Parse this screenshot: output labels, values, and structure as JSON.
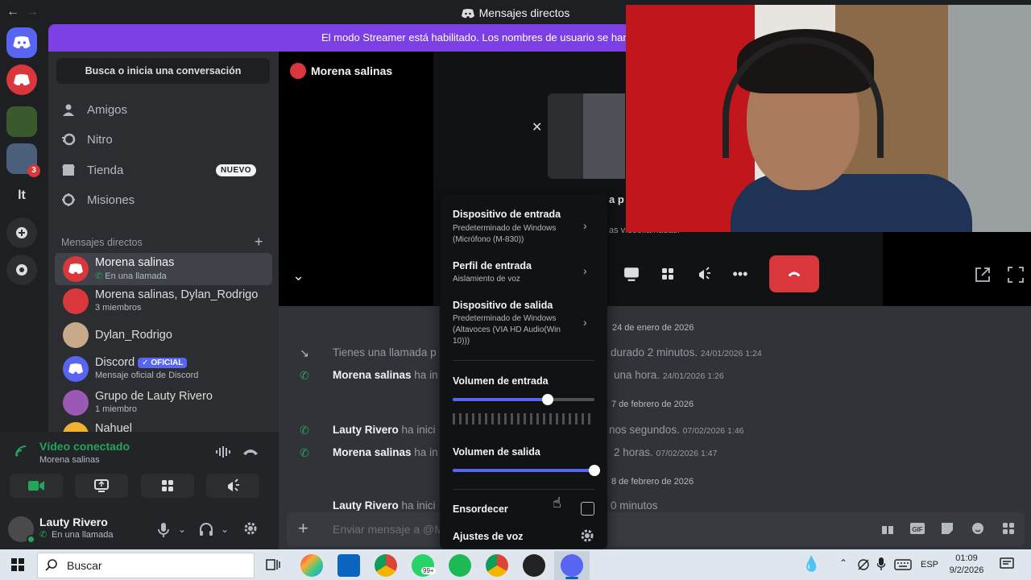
{
  "window": {
    "title": "Mensajes directos",
    "back": "←",
    "forward": "→"
  },
  "banner": {
    "text": "El modo Streamer está habilitado. Los nombres de usuario se han t"
  },
  "sidebar": {
    "search_label": "Busca o inicia una conversación",
    "nav": [
      {
        "label": "Amigos",
        "icon": "friends-icon"
      },
      {
        "label": "Nitro",
        "icon": "nitro-icon"
      },
      {
        "label": "Tienda",
        "icon": "shop-icon",
        "badge": "NUEVO"
      },
      {
        "label": "Misiones",
        "icon": "quests-icon"
      }
    ],
    "dm_header": "Mensajes directos",
    "dm_add": "+",
    "dms": [
      {
        "name": "Morena salinas",
        "sub": "En una llamada",
        "color": "#da373c"
      },
      {
        "name": "Morena salinas, Dylan_Rodrigo",
        "sub": "3 miembros",
        "color": "#da373c"
      },
      {
        "name": "Dylan_Rodrigo",
        "sub": "",
        "color": "#c8a98a"
      },
      {
        "name": "Discord",
        "badge": "OFICIAL",
        "sub": "Mensaje oficial de Discord",
        "color": "#5865f2"
      },
      {
        "name": "Grupo de Lauty Rivero",
        "sub": "1 miembro",
        "color": "#9b59b6"
      },
      {
        "name": "Nahuel",
        "sub": "",
        "color": "#f0b232"
      }
    ]
  },
  "server_rail": {
    "server_label": "lt",
    "badge_count": "3"
  },
  "voice": {
    "title": "Vídeo conectado",
    "subtitle": "Morena salinas"
  },
  "user": {
    "name": "Lauty Rivero",
    "status": "En una llamada"
  },
  "call": {
    "name": "Morena salinas",
    "partial_text": "a p",
    "partial_link": "as videollamadas."
  },
  "chat": {
    "dates": [
      "24 de enero de 2026",
      "7 de febrero de 2026",
      "8 de febrero de 2026"
    ],
    "messages": [
      {
        "left": "Tienes una llamada p",
        "right": "durado 2 minutos.",
        "ts": "24/01/2026 1:24"
      },
      {
        "name": "Morena salinas",
        "left": " ha in",
        "right": "una hora.",
        "ts": "24/01/2026 1:26"
      },
      {
        "name": "Lauty Rivero",
        "left": " ha inici",
        "right": "nos segundos.",
        "ts": "07/02/2026 1:46"
      },
      {
        "name": "Morena salinas",
        "left": " ha in",
        "right": "2 horas.",
        "ts": "07/02/2026 1:47"
      },
      {
        "name": "Lauty Rivero",
        "left": " ha inici",
        "right": "0 minutos",
        "ts": ""
      }
    ],
    "composer_placeholder": "Enviar mensaje a @M"
  },
  "menu": {
    "input_device_title": "Dispositivo de entrada",
    "input_device_sub": "Predeterminado de Windows (Micrófono (M-830))",
    "input_profile_title": "Perfil de entrada",
    "input_profile_sub": "Aislamiento de voz",
    "output_device_title": "Dispositivo de salida",
    "output_device_sub": "Predeterminado de Windows (Altavoces (VIA HD Audio(Win 10)))",
    "input_volume_label": "Volumen de entrada",
    "input_volume": 0.67,
    "output_volume_label": "Volumen de salida",
    "output_volume": 1.0,
    "deafen_label": "Ensordecer",
    "voice_settings_label": "Ajustes de voz"
  },
  "taskbar": {
    "search_label": "Buscar",
    "whatsapp_badge": "99+",
    "language": "ESP",
    "time": "01:09",
    "date": "9/2/2026"
  },
  "colors": {
    "accent": "#5865f2",
    "danger": "#da373c",
    "online": "#23a55a",
    "banner": "#7b3fe4"
  }
}
